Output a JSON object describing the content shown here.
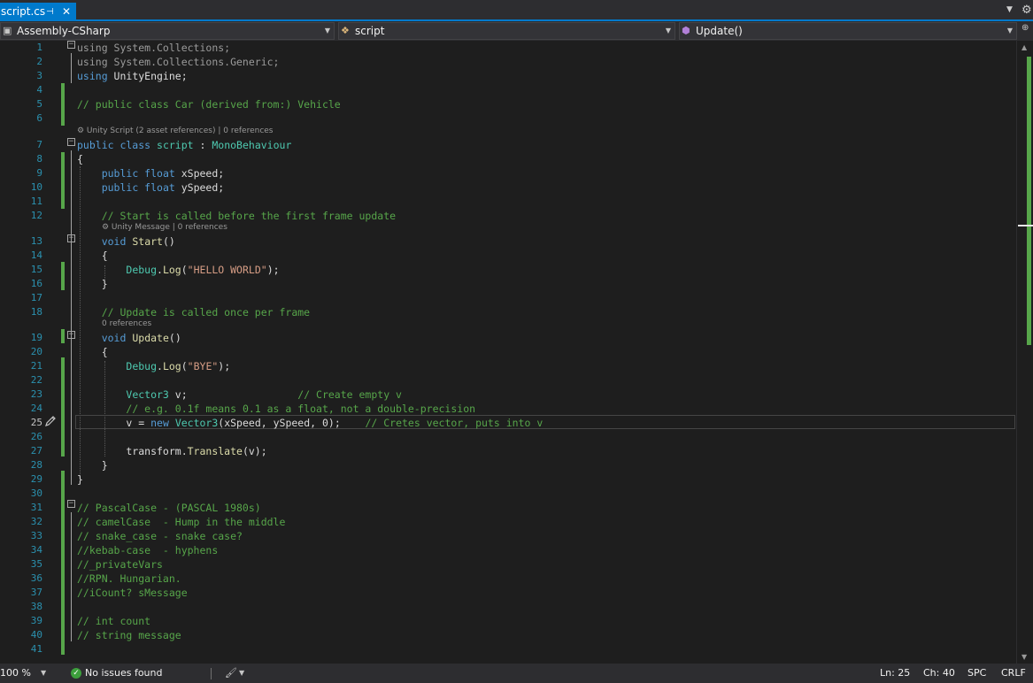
{
  "tab": {
    "filename": "script.cs",
    "pin_glyph": "⊣",
    "close_glyph": "✕"
  },
  "navbar": {
    "project": "Assembly-CSharp",
    "type": "script",
    "member": "Update()"
  },
  "editor": {
    "current_line": 25,
    "lines": [
      {
        "n": "1",
        "html": "<span class=\"dim\">using System.Collections;</span>"
      },
      {
        "n": "2",
        "html": "<span class=\"dim\">using System.Collections.Generic;</span>"
      },
      {
        "n": "3",
        "html": "<span class=\"kw\">using</span> UnityEngine;"
      },
      {
        "n": "4",
        "html": ""
      },
      {
        "n": "5",
        "html": "<span class=\"cm\">// public class Car (derived from:) Vehicle</span>"
      },
      {
        "n": "6",
        "html": ""
      },
      {
        "n": "7",
        "html": "<span class=\"kw\">public class</span> <span class=\"ty\">script</span> : <span class=\"ty\">MonoBehaviour</span>"
      },
      {
        "n": "8",
        "html": "{"
      },
      {
        "n": "9",
        "html": "    <span class=\"kw\">public float</span> xSpeed;"
      },
      {
        "n": "10",
        "html": "    <span class=\"kw\">public float</span> ySpeed;"
      },
      {
        "n": "11",
        "html": ""
      },
      {
        "n": "12",
        "html": "    <span class=\"cm\">// Start is called before the first frame update</span>"
      },
      {
        "n": "13",
        "html": "    <span class=\"kw\">void</span> <span class=\"fn\">Start</span>()"
      },
      {
        "n": "14",
        "html": "    {"
      },
      {
        "n": "15",
        "html": "        <span class=\"ty\">Debug</span>.<span class=\"fn\">Log</span>(<span class=\"st\">\"HELLO WORLD\"</span>);"
      },
      {
        "n": "16",
        "html": "    }"
      },
      {
        "n": "17",
        "html": ""
      },
      {
        "n": "18",
        "html": "    <span class=\"cm\">// Update is called once per frame</span>"
      },
      {
        "n": "19",
        "html": "    <span class=\"kw\">void</span> <span class=\"fn\">Update</span>()"
      },
      {
        "n": "20",
        "html": "    {"
      },
      {
        "n": "21",
        "html": "        <span class=\"ty\">Debug</span>.<span class=\"fn\">Log</span>(<span class=\"st\">\"BYE\"</span>);"
      },
      {
        "n": "22",
        "html": ""
      },
      {
        "n": "23",
        "html": "        <span class=\"ty\">Vector3</span> v;                  <span class=\"cm\">// Create empty v</span>"
      },
      {
        "n": "24",
        "html": "        <span class=\"cm\">// e.g. 0.1f means 0.1 as a float, not a double-precision</span>"
      },
      {
        "n": "25",
        "html": "        v = <span class=\"kw\">new</span> <span class=\"ty\">Vector3</span>(xSpeed, ySpeed, 0);    <span class=\"cm\">// Cretes vector, puts into v</span>"
      },
      {
        "n": "26",
        "html": ""
      },
      {
        "n": "27",
        "html": "        transform.<span class=\"fn\">Translate</span>(v);"
      },
      {
        "n": "28",
        "html": "    }"
      },
      {
        "n": "29",
        "html": "}"
      },
      {
        "n": "30",
        "html": ""
      },
      {
        "n": "31",
        "html": "<span class=\"cm\">// PascalCase - (PASCAL 1980s)</span>"
      },
      {
        "n": "32",
        "html": "<span class=\"cm\">// camelCase  - Hump in the middle</span>"
      },
      {
        "n": "33",
        "html": "<span class=\"cm\">// snake_case - snake case?</span>"
      },
      {
        "n": "34",
        "html": "<span class=\"cm\">//kebab-case  - hyphens</span>"
      },
      {
        "n": "35",
        "html": "<span class=\"cm\">//_privateVars</span>"
      },
      {
        "n": "36",
        "html": "<span class=\"cm\">//RPN. Hungarian.</span>"
      },
      {
        "n": "37",
        "html": "<span class=\"cm\">//iCount? sMessage</span>"
      },
      {
        "n": "38",
        "html": ""
      },
      {
        "n": "39",
        "html": "<span class=\"cm\">// int count</span>"
      },
      {
        "n": "40",
        "html": "<span class=\"cm\">// string message</span>"
      },
      {
        "n": "41",
        "html": ""
      }
    ],
    "code_lens": {
      "class": "⚙ Unity Script (2 asset references) | 0 references",
      "start": "⚙ Unity Message | 0 references",
      "update": "0 references"
    }
  },
  "statusbar": {
    "zoom": "100 %",
    "issues": "No issues found",
    "line": "Ln: 25",
    "col": "Ch: 40",
    "spacing": "SPC",
    "line_ending": "CRLF"
  },
  "colors": {
    "accent": "#007acc",
    "keyword": "#569cd6",
    "comment": "#57a64a",
    "type": "#4ec9b0",
    "string": "#d69d85",
    "line_number": "#2b91af"
  }
}
